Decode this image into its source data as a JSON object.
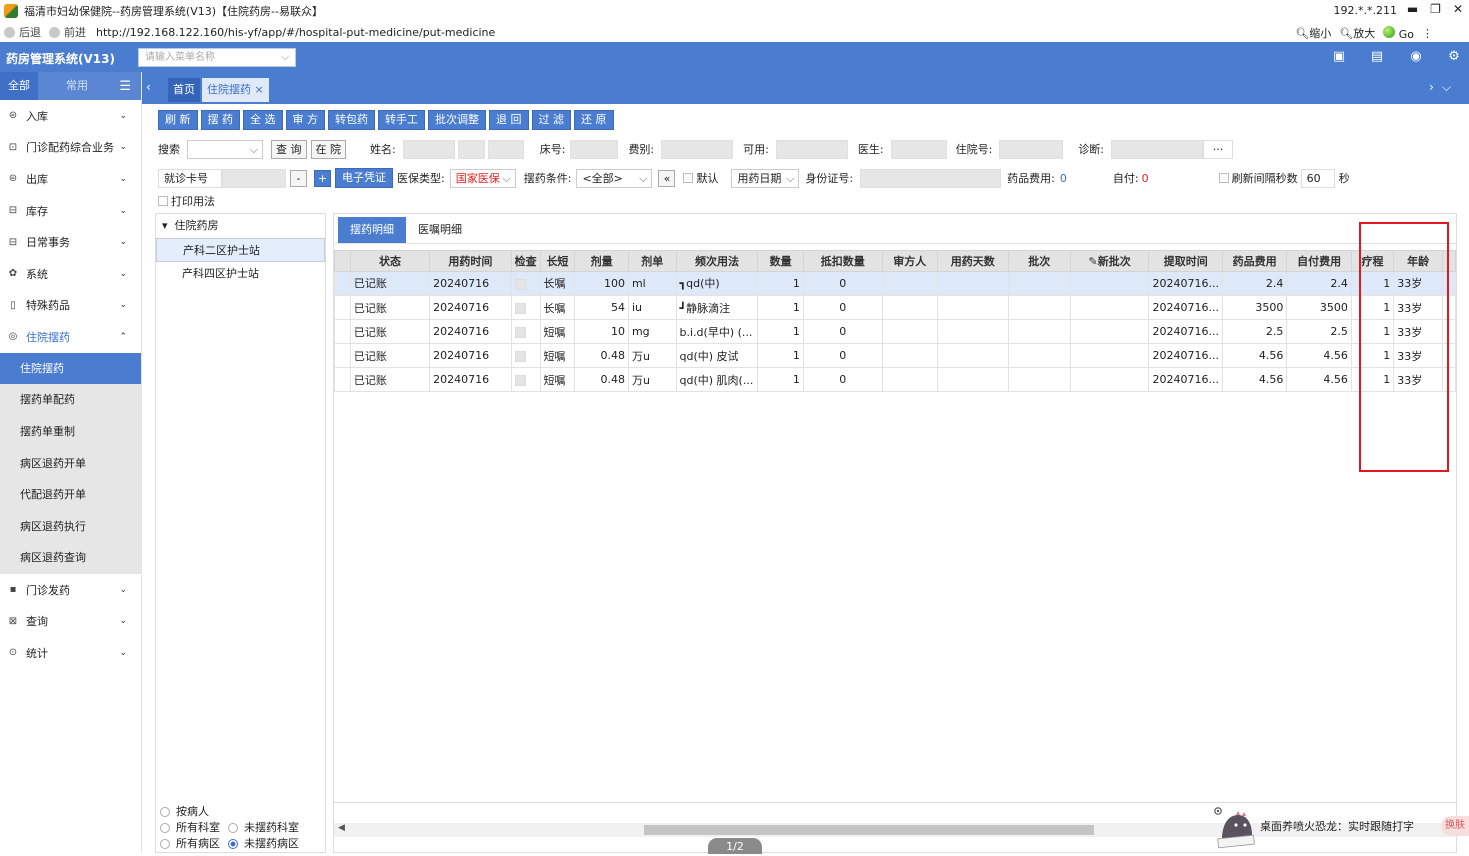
{
  "window": {
    "title": "福清市妇幼保健院--药房管理系统(V13)【住院药房--易联众】",
    "ip": "192.*.*.211"
  },
  "browser": {
    "back": "后退",
    "forward": "前进",
    "url": "http://192.168.122.160/his-yf/app/#/hospital-put-medicine/put-medicine",
    "zoom_out": "缩小",
    "zoom_in": "放大",
    "go": "Go"
  },
  "app": {
    "brand": "药房管理系统(V13)",
    "menu_search_placeholder": "请输入菜单名称"
  },
  "sidebar": {
    "tabs": [
      "全部",
      "常用"
    ],
    "menus": [
      {
        "label": "入库",
        "icon": "inbox-icon"
      },
      {
        "label": "门诊配药综合业务",
        "icon": "clinic-icon"
      },
      {
        "label": "出库",
        "icon": "outbox-icon"
      },
      {
        "label": "库存",
        "icon": "stock-icon"
      },
      {
        "label": "日常事务",
        "icon": "daily-icon"
      },
      {
        "label": "系统",
        "icon": "gear-icon"
      },
      {
        "label": "特殊药品",
        "icon": "special-drug-icon"
      },
      {
        "label": "住院摆药",
        "icon": "inpatient-icon"
      }
    ],
    "submenu": [
      "住院摆药",
      "摆药单配药",
      "摆药单重制",
      "病区退药开单",
      "代配退药开单",
      "病区退药执行",
      "病区退药查询"
    ],
    "menus_after": [
      {
        "label": "门诊发药",
        "icon": "outpatient-icon"
      },
      {
        "label": "查询",
        "icon": "query-icon"
      },
      {
        "label": "统计",
        "icon": "stats-icon"
      }
    ]
  },
  "tabs": {
    "home": "首页",
    "current": "住院摆药"
  },
  "toolbar": [
    "刷 新",
    "摆 药",
    "全 选",
    "审 方",
    "转包药",
    "转手工",
    "批次调整",
    "退 回",
    "过 滤",
    "还 原"
  ],
  "filters": {
    "search": "搜索",
    "query": "查 询",
    "in_hospital": "在 院",
    "name": "姓名:",
    "bed": "床号:",
    "category": "费别:",
    "available": "可用:",
    "doctor": "医生:",
    "admission_no": "住院号:",
    "diagnosis": "诊断:",
    "diag_more": "···",
    "card_type": "就诊卡号",
    "minus": "-",
    "plus": "+",
    "e_cert": "电子凭证",
    "ins_type": "医保类型:",
    "ins_value": "国家医保",
    "condition": "摆药条件:",
    "condition_value": "<全部>",
    "collapse": "«",
    "default": "默认",
    "date_type": "用药日期",
    "id_no": "身份证号:",
    "drug_fee": "药品费用:",
    "drug_fee_value": "0",
    "self_pay": "自付:",
    "self_pay_value": "0",
    "refresh_interval": "刷新间隔秒数",
    "interval_value": "60",
    "seconds": "秒",
    "print_usage": "打印用法"
  },
  "tree": {
    "root": "住院药房",
    "children": [
      "产科二区护士站",
      "产科四区护士站"
    ],
    "radios": [
      [
        {
          "label": "按病人",
          "on": false
        }
      ],
      [
        {
          "label": "所有科室",
          "on": false
        },
        {
          "label": "未摆药科室",
          "on": false
        }
      ],
      [
        {
          "label": "所有病区",
          "on": false
        },
        {
          "label": "未摆药病区",
          "on": true
        }
      ]
    ]
  },
  "grid": {
    "tabs": [
      "摆药明细",
      "医嘱明细"
    ],
    "columns": [
      "状态",
      "用药时间",
      "检查",
      "长短",
      "剂量",
      "剂单",
      "频次用法",
      "数量",
      "抵扣数量",
      "审方人",
      "用药天数",
      "批次",
      "新批次",
      "提取时间",
      "药品费用",
      "自付费用",
      "疗程",
      "年龄"
    ],
    "rows": [
      [
        "已记账",
        "20240716",
        "",
        "长嘱",
        "100",
        "ml",
        "┓qd(中)",
        "1",
        "0",
        "",
        "",
        "",
        "",
        "20240716...",
        "2.4",
        "2.4",
        "1",
        "33岁"
      ],
      [
        "已记账",
        "20240716",
        "",
        "长嘱",
        "54",
        "iu",
        "┛静脉滴注",
        "1",
        "0",
        "",
        "",
        "",
        "",
        "20240716...",
        "3500",
        "3500",
        "1",
        "33岁"
      ],
      [
        "已记账",
        "20240716",
        "",
        "短嘱",
        "10",
        "mg",
        "b.i.d(早中) (...",
        "1",
        "0",
        "",
        "",
        "",
        "",
        "20240716...",
        "2.5",
        "2.5",
        "1",
        "33岁"
      ],
      [
        "已记账",
        "20240716",
        "",
        "短嘱",
        "0.48",
        "万u",
        "qd(中) 皮试",
        "1",
        "0",
        "",
        "",
        "",
        "",
        "20240716...",
        "4.56",
        "4.56",
        "1",
        "33岁"
      ],
      [
        "已记账",
        "20240716",
        "",
        "短嘱",
        "0.48",
        "万u",
        "qd(中) 肌肉(...",
        "1",
        "0",
        "",
        "",
        "",
        "",
        "20240716...",
        "4.56",
        "4.56",
        "1",
        "33岁"
      ]
    ],
    "pager": "1/2"
  },
  "ime": {
    "text": "桌面养喷火恐龙：实时跟随打字",
    "swap": "换肤"
  },
  "colors": {
    "primary": "#4a7ccf",
    "highlight": "#e0191e",
    "insurance_red": "#e02020"
  }
}
